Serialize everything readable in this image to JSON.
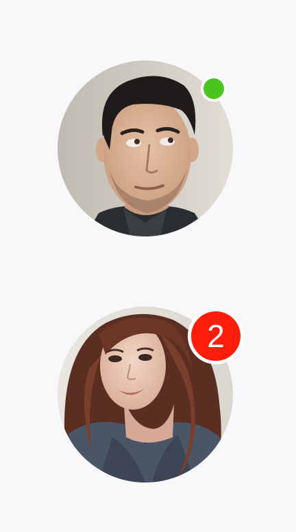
{
  "colors": {
    "background": "#f8f8fa",
    "online": "#4cc41e",
    "badge": "#ff1e0a",
    "ring": "#ffffff"
  },
  "avatars": [
    {
      "icon": "man-portrait",
      "status": "online"
    },
    {
      "icon": "woman-portrait",
      "badge_count": "2"
    }
  ]
}
